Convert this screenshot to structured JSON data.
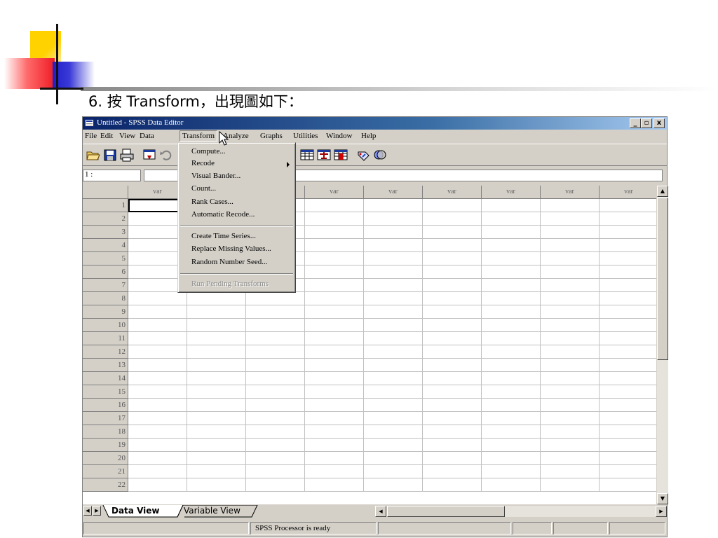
{
  "slide": {
    "title": "6. 按 Transform，出現圖如下："
  },
  "window": {
    "title": "Untitled - SPSS Data Editor",
    "controls": {
      "minimize": "_",
      "maximize": "▫",
      "close": "x"
    }
  },
  "menubar": [
    {
      "label": "File"
    },
    {
      "label": "Edit"
    },
    {
      "label": "View"
    },
    {
      "label": "Data"
    },
    {
      "label": "Transform"
    },
    {
      "label": "Analyze"
    },
    {
      "label": "Graphs"
    },
    {
      "label": "Utilities"
    },
    {
      "label": "Window"
    },
    {
      "label": "Help"
    }
  ],
  "toolbar": [
    {
      "icon": "open-icon"
    },
    {
      "icon": "save-icon"
    },
    {
      "icon": "print-icon"
    },
    {
      "icon": "dialog-recall-icon"
    },
    {
      "icon": "undo-icon"
    },
    {
      "icon": "split-file-icon"
    },
    {
      "icon": "weight-cases-icon"
    },
    {
      "icon": "select-cases-icon"
    },
    {
      "icon": "value-labels-icon"
    },
    {
      "icon": "use-sets-icon"
    }
  ],
  "cell_editor": {
    "ref": "1 :",
    "value": ""
  },
  "grid": {
    "column_header": "var",
    "column_count": 9,
    "rows": [
      "1",
      "2",
      "3",
      "4",
      "5",
      "6",
      "7",
      "8",
      "9",
      "10",
      "11",
      "12",
      "13",
      "14",
      "15",
      "16",
      "17",
      "18",
      "19",
      "20",
      "21",
      "22"
    ]
  },
  "tabs": {
    "data_view": "Data View",
    "variable_view": "Variable View"
  },
  "status": {
    "processor": "SPSS Processor  is ready"
  },
  "transform_menu": {
    "items": [
      {
        "label": "Compute...",
        "enabled": true
      },
      {
        "label": "Recode",
        "enabled": true,
        "submenu": true
      },
      {
        "label": "Visual Bander...",
        "enabled": true
      },
      {
        "label": "Count...",
        "enabled": true
      },
      {
        "label": "Rank Cases...",
        "enabled": true
      },
      {
        "label": "Automatic Recode...",
        "enabled": true
      },
      {
        "label": "Create Time Series...",
        "enabled": true
      },
      {
        "label": "Replace Missing Values...",
        "enabled": true
      },
      {
        "label": "Random Number Seed...",
        "enabled": true
      },
      {
        "label": "Run Pending Transforms",
        "enabled": false
      }
    ]
  }
}
